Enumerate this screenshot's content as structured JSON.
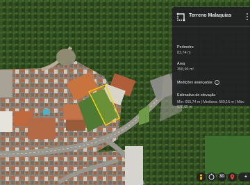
{
  "panel": {
    "title": "Terreno Malaquias",
    "perimeter_label": "Perímetro",
    "perimeter_value": "83,74 m",
    "area_label": "Área",
    "area_value": "356,96 m²",
    "advanced_label": "Medições avançadas",
    "elevation_label": "Estimativa de elevação",
    "elevation_value": "Mín: 665,74 m | Mediana: 669,16 m | Máx: 670,65 m",
    "measure_icon": "measure-icon",
    "info_icon": "info-icon",
    "more_icon": "more-vert-icon"
  },
  "toolbar": {
    "person_icon": "street-view-icon",
    "reset_icon": "compass-reset-icon",
    "view_3d_label": "3D",
    "location_icon": "location-icon",
    "zoom_label": "+"
  },
  "colors": {
    "panel_bg": "#202124",
    "outline": "#f2d600",
    "forest": "#2d4a1f"
  }
}
